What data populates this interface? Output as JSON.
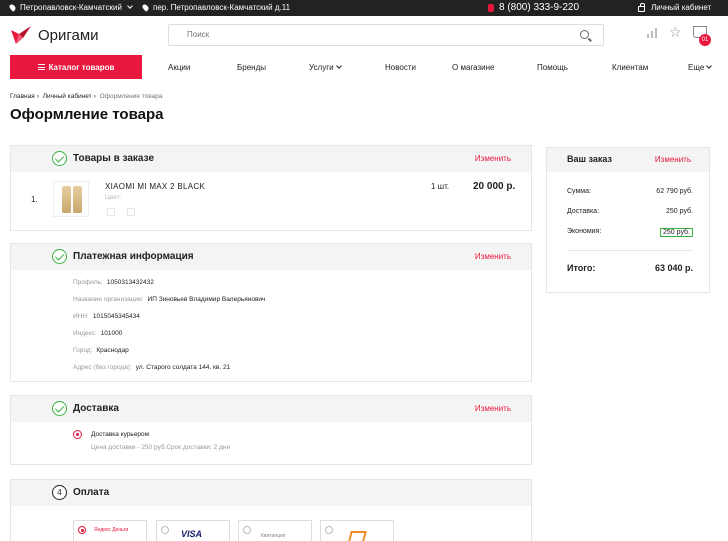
{
  "topbar": {
    "city": "Петропавловск-Камчатский",
    "address": "пер. Петропавловск-Камчатский д.11",
    "phone": "8 (800) 333-9-220",
    "account": "Личный кабинет"
  },
  "header": {
    "logo_text": "Оригами",
    "search_placeholder": "Поиск",
    "cart_badge": "01"
  },
  "nav": {
    "catalog_label": "Каталог товаров",
    "items": [
      "Акции",
      "Бренды",
      "Услуги",
      "Новости",
      "О магазине",
      "Помощь",
      "Клиентам",
      "Еще"
    ]
  },
  "breadcrumb": [
    "Главная",
    "Личный кабинет",
    "Оформление товара"
  ],
  "page_title": "Оформление товара",
  "sections": {
    "order": {
      "title": "Товары в заказе",
      "edit": "Изменить",
      "item": {
        "index": "1.",
        "name": "XIAOMI MI MAX 2 BLACK",
        "color_label": "Цвет:",
        "qty": "1 шт.",
        "price": "20 000 р."
      }
    },
    "payment_info": {
      "title": "Платежная информация",
      "edit": "Изменить",
      "rows": [
        {
          "label": "Профиль:",
          "value": "1050313432432"
        },
        {
          "label": "Название организации:",
          "value": "ИП Зиновьев Владимир Валерьянович"
        },
        {
          "label": "ИНН:",
          "value": "1015045345434"
        },
        {
          "label": "Индекс:",
          "value": "101000"
        },
        {
          "label": "Город:",
          "value": "Краснодар"
        },
        {
          "label": "Адрес (без города):",
          "value": "ул. Старого солдата 144, кв. 21"
        }
      ]
    },
    "delivery": {
      "title": "Доставка",
      "edit": "Изменить",
      "option": "Доставка курьером",
      "note": "Цена доставки - 250 руб.Срок доставки: 2 дня"
    },
    "payment": {
      "number": "4",
      "title": "Оплата",
      "methods": [
        "Яндекс Деньги",
        "VISA",
        "Квитанция",
        ""
      ]
    }
  },
  "summary": {
    "title": "Ваш заказ",
    "edit": "Изменить",
    "rows": [
      {
        "label": "Сумма:",
        "value": "62 790 руб."
      },
      {
        "label": "Доставка:",
        "value": "250 руб."
      },
      {
        "label": "Экономия:",
        "value": "250 руб."
      }
    ],
    "total_label": "Итого:",
    "total_value": "63 040 р."
  },
  "colors": {
    "accent": "#e8173d",
    "success": "#3cb043",
    "topbar": "#222222"
  }
}
